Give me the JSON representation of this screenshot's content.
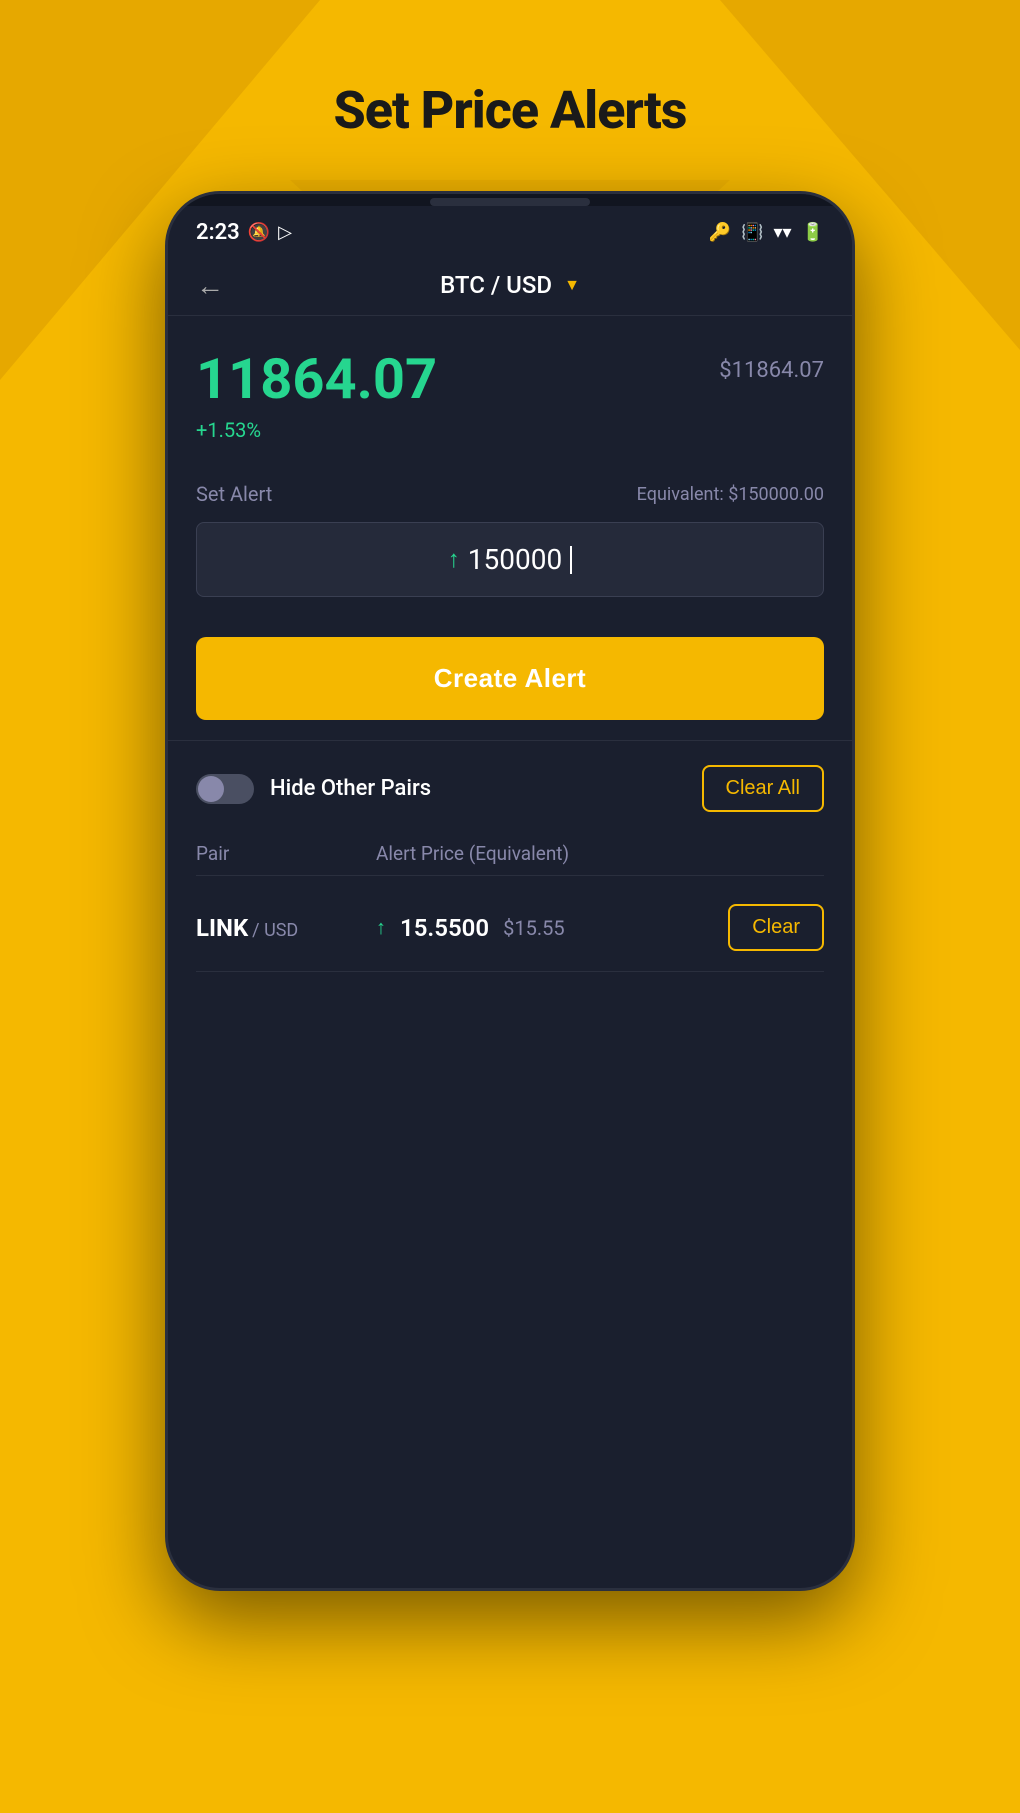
{
  "page": {
    "title": "Set Price Alerts",
    "background_color": "#F5B800"
  },
  "status_bar": {
    "time": "2:23",
    "icons_left": [
      "notification",
      "play"
    ],
    "icons_right": [
      "key",
      "vibrate",
      "wifi",
      "battery"
    ]
  },
  "nav": {
    "back_label": "←",
    "pair": "BTC / USD",
    "dropdown_arrow": "▼"
  },
  "price": {
    "main": "11864.07",
    "usd_equiv": "$11864.07",
    "change": "+1.53%"
  },
  "alert_form": {
    "label": "Set Alert",
    "equivalent": "Equivalent: $150000.00",
    "input_arrow": "↑",
    "input_value": "150000",
    "create_button": "Create Alert"
  },
  "alerts_list": {
    "hide_pairs_label": "Hide Other Pairs",
    "clear_all_label": "Clear All",
    "headers": {
      "pair": "Pair",
      "price": "Alert Price (Equivalent)"
    },
    "items": [
      {
        "pair_name": "LINK",
        "pair_quote": "/ USD",
        "direction": "↑",
        "price": "15.5500",
        "equiv": "$15.55",
        "clear_label": "Clear"
      }
    ]
  }
}
